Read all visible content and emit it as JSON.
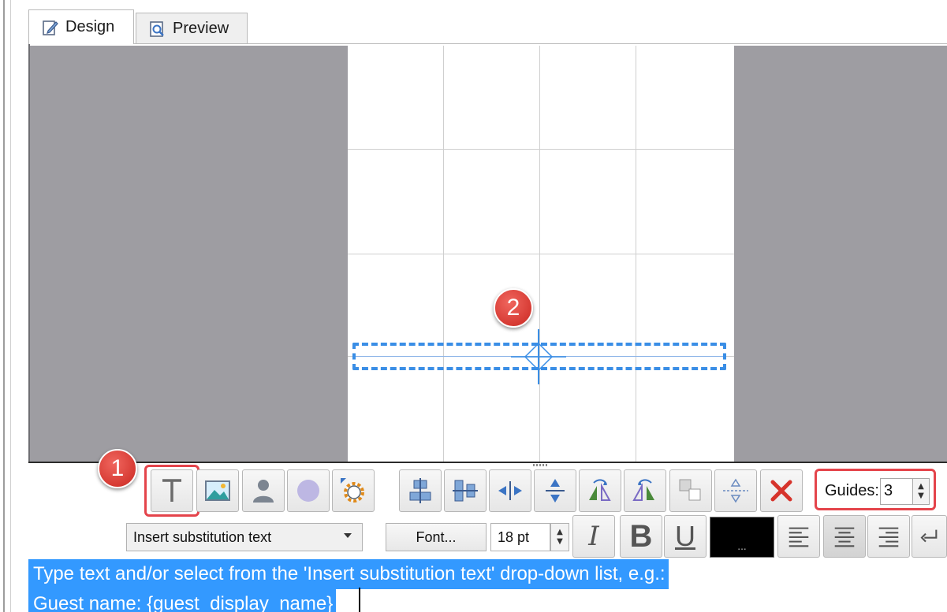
{
  "tabs": [
    {
      "label": "Design",
      "icon": "pencil-page-icon",
      "active": true
    },
    {
      "label": "Preview",
      "icon": "magnifier-page-icon",
      "active": false
    }
  ],
  "callouts": {
    "one": "1",
    "two": "2"
  },
  "toolbar": {
    "insert_items": [
      "text-tool-icon",
      "image-icon",
      "person-icon",
      "circle-icon",
      "gear-icon"
    ],
    "align_items": [
      "align-horizontal-center-icon",
      "align-vertical-center-icon",
      "center-horizontal-icon",
      "center-vertical-icon",
      "rotate-right-icon",
      "rotate-left-icon",
      "layer-order-icon",
      "snap-guides-icon",
      "delete-icon"
    ],
    "guides_label": "Guides:",
    "guides_value": "3"
  },
  "format": {
    "substitution_placeholder": "Insert substitution text",
    "font_button": "Font...",
    "font_size": "18 pt",
    "italic": "I",
    "bold": "B",
    "underline": "U",
    "color_button": "...",
    "text_color": "#000000"
  },
  "editor": {
    "line1": "Type text and/or select from the 'Insert substitution text' drop-down list, e.g.:",
    "line2": "Guest name: {guest_display_name}"
  },
  "colors": {
    "selection": "#3399ff",
    "callout": "#d63a33",
    "canvas_background": "#9e9da2",
    "text_box_border": "#3a8ee6"
  }
}
